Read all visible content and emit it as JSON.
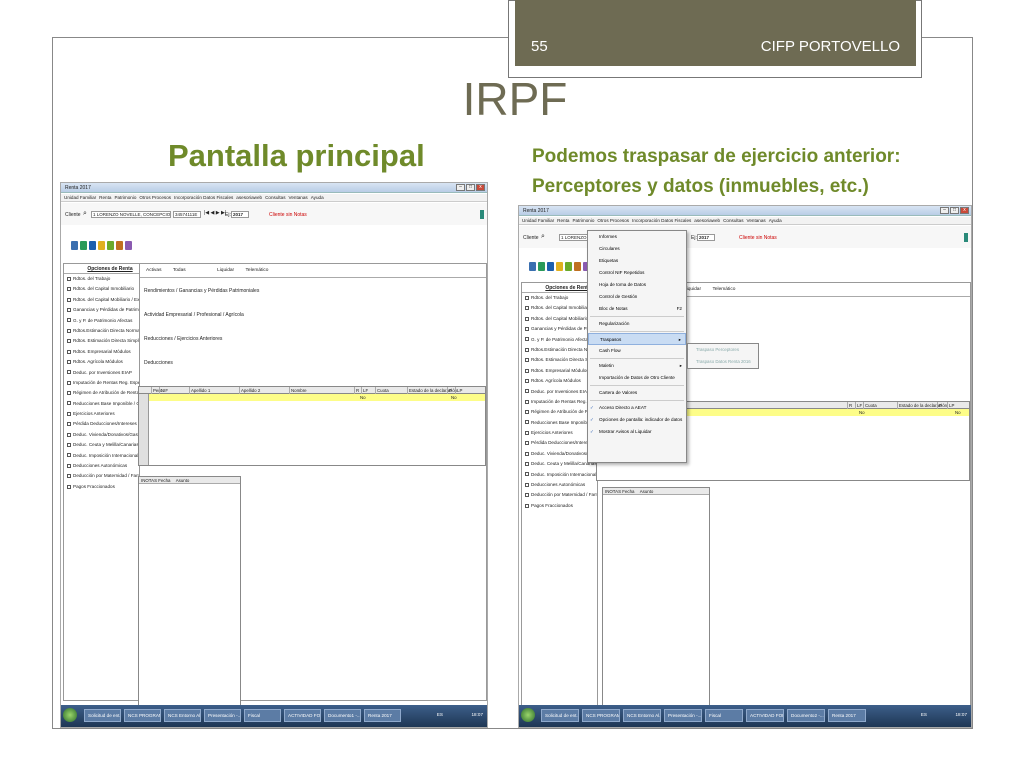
{
  "header": {
    "slide_number": "55",
    "school": "CIFP PORTOVELLO",
    "title": "IRPF"
  },
  "subtitle": "Pantalla principal",
  "right_note": {
    "line1": "Podemos traspasar de ejercicio anterior:",
    "line2": "Perceptores y datos  (inmuebles, etc.)"
  },
  "colors": {
    "header_bar": "#6e6b53",
    "title": "#6e6b53",
    "accent_green": "#6f8a2a",
    "row_highlight": "#fdfd88"
  },
  "left_app": {
    "window_title": "Renta 2017",
    "menu": [
      "Unidad Familiar",
      "Renta",
      "Patrimonio",
      "Otros Procesos",
      "Incorporación Datos Fiscales",
      "asesoriaweb",
      "Consultas",
      "Ventanas",
      "Ayuda"
    ],
    "client_label": "Cliente",
    "client_name": "1 LORENZO NOVELLE, CONCEPCION",
    "client_id": "34574111E",
    "year_label": "Ej:",
    "year": "2017",
    "client_note": "Cliente sin Notas",
    "options_title": "Opciones de Renta",
    "options": [
      "Rdtos. del Trabajo",
      "Rdtos. del Capital Inmobiliario",
      "Rdtos. del Capital Mobiliario / Exentos",
      "Ganancias y Pérdidas de Patrimonio",
      "G. y P. de Patrimonio Afectas",
      "Rdtos.Estimación Directa Normal",
      "Rdtos. Estimación Directa Simplificada",
      "Rdtos. Empresarial Módulos",
      "Rdtos. Agrícola Módulos",
      "Deduc. por Inversiones EIAP",
      "Imputación de Rentas Reg. Especiales",
      "Régimen de Atribución de Rentas",
      "Reducciones Base Imponible / Otras",
      "Ejercicios Anteriores",
      "Pérdida Deducciones/Intereses Demora",
      "Deduc. Vivienda/Donativos/Gastos...",
      "Deduc. Ceuta y Melilla/Canarias",
      "Deduc. Imposición Internacional",
      "Deducciones Autonómicas",
      "Deducción por Maternidad / Familiares",
      "Pagos Fraccionados"
    ],
    "tabs": [
      "Activas",
      "Todas",
      "Liquidar",
      "Telemático"
    ],
    "sections": [
      "Rendimientos / Ganancias y Pérdidas Patrimoniales",
      "Actividad Empresarial / Profesional / Agrícola",
      "Reducciones / Ejercicios Anteriores",
      "Deducciones"
    ],
    "grid_headers": [
      "Perc.",
      "NIF",
      "Apellido 1",
      "Apellido 2",
      "Nombre",
      "R",
      "LF",
      "Cuota",
      "Estado de la declaración",
      "P",
      "LP"
    ],
    "grid_row": [
      "No",
      "No"
    ],
    "notes_headers": [
      "INOTAS",
      "Fecha",
      "Asunto"
    ]
  },
  "right_app": {
    "window_title": "Renta 2017",
    "menu": [
      "Unidad Familiar",
      "Renta",
      "Patrimonio",
      "Otros Procesos",
      "Incorporación Datos Fiscales",
      "asesoriaweb",
      "Consultas",
      "Ventanas",
      "Ayuda"
    ],
    "client_label": "Cliente",
    "client_name": "1 LORENZO NOV",
    "year_label": "Ej:",
    "year": "2017",
    "client_note": "Cliente sin Notas",
    "options_title": "Opciones de Renta",
    "tabs": [
      "Liquidar",
      "Telemático"
    ],
    "grid_headers": [
      "Apellido 2",
      "Nombre",
      "R",
      "LF",
      "Cuota",
      "Estado de la declaración",
      "P",
      "LP"
    ],
    "grid_row": [
      "No",
      "No"
    ],
    "notes_headers": [
      "INOTAS",
      "Fecha",
      "Asunto"
    ],
    "dropdown": {
      "items": [
        "Informes",
        "Circulares",
        "Etiquetas",
        "Control NIF Repetidos",
        "Hoja de toma de Datos",
        "Control de Gestión",
        "Bloc de Notas",
        "Regularización",
        "Traspasos",
        "Cash Flow",
        "Maletin",
        "Importación de Datos de Otro Cliente",
        "Cartera de Valores",
        "Acceso Directo a AEAT",
        "Opciones de pantalla: indicador de datos",
        "Mostrar Avisos al Liquidar"
      ],
      "shortcut": "F2",
      "submenu": [
        "Traspaso Perceptores",
        "Traspaso Datos Renta 2016"
      ]
    }
  },
  "taskbar": {
    "left": [
      "Solicitud de ent...",
      "NCS PROGRAM...",
      "NCS Entorno Al...",
      "Presentación -...",
      "Fiscal",
      "ACTIVIDAD FOR...",
      "Documento1 -...",
      "Renta 2017"
    ],
    "right": [
      "Solicitud de ent...",
      "NCS PROGRAM...",
      "NCS Entorno Al...",
      "Presentación -...",
      "Fiscal",
      "ACTIVIDAD FOR...",
      "Documento2 -...",
      "Renta 2017"
    ],
    "lang": "ES",
    "clock": "18:07"
  }
}
